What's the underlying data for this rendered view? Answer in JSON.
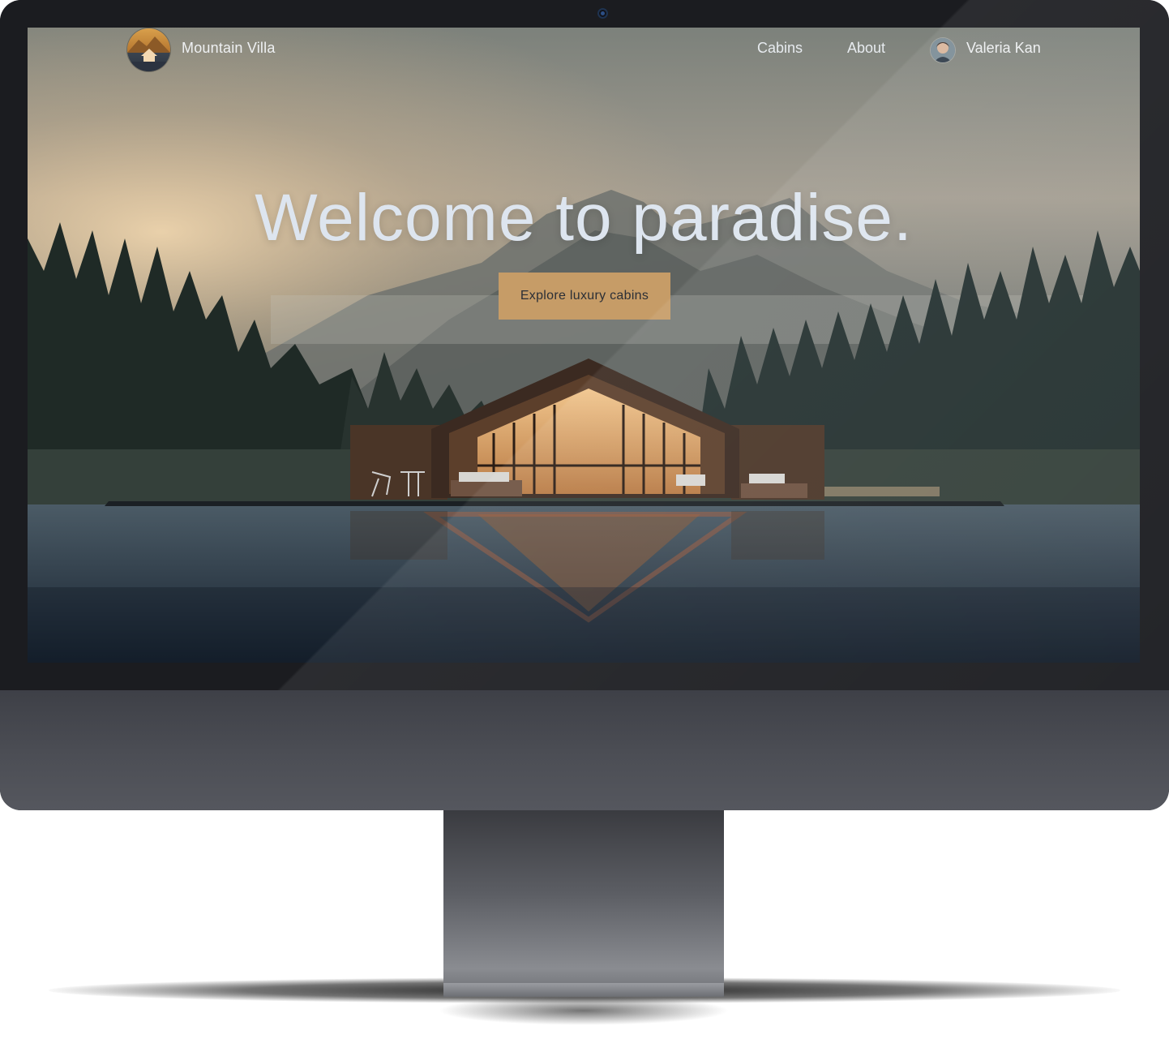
{
  "brand": {
    "name": "Mountain Villa"
  },
  "nav": {
    "links": [
      "Cabins",
      "About"
    ]
  },
  "user": {
    "name": "Valeria Kan"
  },
  "hero": {
    "title": "Welcome to paradise.",
    "cta_label": "Explore luxury cabins"
  },
  "colors": {
    "accent": "#c69c67",
    "text": "#dde5ef",
    "bezel": "#1b1c20",
    "chin": "#4c4e55"
  },
  "icons": {
    "logo": "mountain-cabin-logo",
    "avatar": "user-avatar",
    "camera": "webcam"
  }
}
